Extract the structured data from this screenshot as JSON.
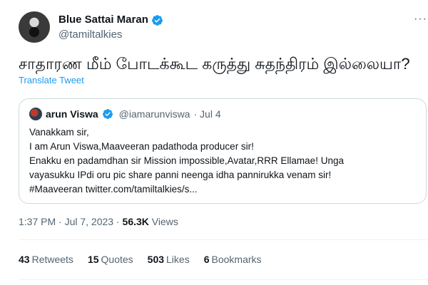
{
  "tweet": {
    "author": {
      "name": "Blue Sattai Maran",
      "handle": "@tamiltalkies"
    },
    "text": "சாதாரண மீம் போடக்கூட கருத்து சுதந்திரம் இல்லையா?",
    "translate_label": "Translate Tweet",
    "quoted": {
      "name": "arun Viswa",
      "handle": "@iamarunviswa",
      "date": "· Jul 4",
      "lines": [
        "Vanakkam sir,",
        "I am Arun Viswa,Maaveeran padathoda producer sir!",
        "Enakku en padamdhan sir Mission impossible,Avatar,RRR Ellamae! Unga",
        "vayasukku IPdi oru pic share panni neenga idha pannirukka venam sir!",
        "#Maaveeran twitter.com/tamiltalkies/s..."
      ]
    },
    "meta": {
      "timestamp": "1:37 PM · Jul 7, 2023 · ",
      "views_count": "56.3K",
      "views_label": " Views"
    },
    "stats": [
      {
        "count": "43",
        "label": "Retweets"
      },
      {
        "count": "15",
        "label": "Quotes"
      },
      {
        "count": "503",
        "label": "Likes"
      },
      {
        "count": "6",
        "label": "Bookmarks"
      }
    ]
  },
  "colors": {
    "verified": "#1d9bf0",
    "link": "#1d9bf0",
    "muted": "#536471"
  },
  "icons": {
    "verified": "verified-badge-icon",
    "more": "more-icon"
  }
}
